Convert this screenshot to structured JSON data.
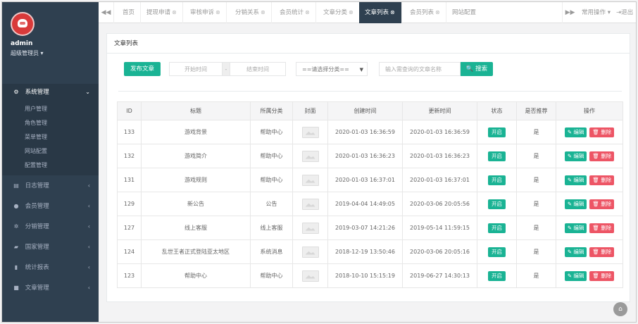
{
  "sidebar": {
    "user_name": "admin",
    "user_role": "超级管理员 ▾",
    "active_menu": {
      "icon": "gear-icon",
      "glyph": "⚙",
      "label": "系统管理",
      "chevron": "⌄"
    },
    "submenu": [
      "用户管理",
      "角色管理",
      "菜单管理",
      "网站配置",
      "配置管理"
    ],
    "menus": [
      {
        "icon": "log-icon",
        "glyph": "▤",
        "label": "日志管理",
        "chevron": "‹"
      },
      {
        "icon": "user-icon",
        "glyph": "●",
        "label": "会员管理",
        "chevron": "‹"
      },
      {
        "icon": "network-icon",
        "glyph": "✲",
        "label": "分销管理",
        "chevron": "‹"
      },
      {
        "icon": "book-icon",
        "glyph": "▰",
        "label": "国家管理",
        "chevron": "‹"
      },
      {
        "icon": "chart-icon",
        "glyph": "▮",
        "label": "统计报表",
        "chevron": "‹"
      },
      {
        "icon": "document-icon",
        "glyph": "■",
        "label": "文章管理",
        "chevron": "‹"
      }
    ]
  },
  "tabbar": {
    "back_glyph": "◀◀",
    "close_glyph": "⊗",
    "tabs": [
      {
        "label": "首页",
        "closable": false,
        "active": false
      },
      {
        "label": "提现申请",
        "closable": true,
        "active": false
      },
      {
        "label": "审核申诉",
        "closable": true,
        "active": false
      },
      {
        "label": "分销关系",
        "closable": true,
        "active": false
      },
      {
        "label": "会员统计",
        "closable": true,
        "active": false
      },
      {
        "label": "文章分类",
        "closable": true,
        "active": false
      },
      {
        "label": "文章列表",
        "closable": true,
        "active": true
      },
      {
        "label": "会员列表",
        "closable": true,
        "active": false
      },
      {
        "label": "网站配置",
        "closable": false,
        "active": false
      }
    ],
    "forward_glyph": "▶▶",
    "common_ops": "常用操作 ▾",
    "logout": "⇥退出"
  },
  "panel": {
    "title": "文章列表",
    "publish_button": "发布文章",
    "start_time_placeholder": "开始时间",
    "range_sep": "-",
    "end_time_placeholder": "结束时间",
    "category_select": "==请选择分类==",
    "select_arrow": "▼",
    "search_placeholder": "输入需查询的文章名称",
    "search_button": "🔍 搜索"
  },
  "table": {
    "headers": [
      "ID",
      "标题",
      "所属分类",
      "封面",
      "创建时间",
      "更新时间",
      "状态",
      "是否推荐",
      "操作"
    ],
    "edit_label": "✎ 编辑",
    "delete_label": "🗑 删除",
    "rows": [
      {
        "id": "133",
        "title": "游戏背景",
        "category": "帮助中心",
        "created": "2020-01-03 16:36:59",
        "updated": "2020-01-03 16:36:59",
        "status": "开启",
        "recommended": "是"
      },
      {
        "id": "132",
        "title": "游戏简介",
        "category": "帮助中心",
        "created": "2020-01-03 16:36:23",
        "updated": "2020-01-03 16:36:23",
        "status": "开启",
        "recommended": "是"
      },
      {
        "id": "131",
        "title": "游戏规则",
        "category": "帮助中心",
        "created": "2020-01-03 16:37:01",
        "updated": "2020-01-03 16:37:01",
        "status": "开启",
        "recommended": "是"
      },
      {
        "id": "129",
        "title": "新公告",
        "category": "公告",
        "created": "2019-04-04 14:49:05",
        "updated": "2020-03-06 20:05:56",
        "status": "开启",
        "recommended": "是"
      },
      {
        "id": "127",
        "title": "线上客服",
        "category": "线上客服",
        "created": "2019-03-07 14:21:26",
        "updated": "2019-05-14 11:59:15",
        "status": "开启",
        "recommended": "是"
      },
      {
        "id": "124",
        "title": "乱世王者正式登陆亚太地区",
        "category": "系统消息",
        "created": "2018-12-19 13:50:46",
        "updated": "2020-03-06 20:05:16",
        "status": "开启",
        "recommended": "是"
      },
      {
        "id": "123",
        "title": "帮助中心",
        "category": "帮助中心",
        "created": "2018-10-10 15:15:19",
        "updated": "2019-06-27 14:30:13",
        "status": "开启",
        "recommended": "是"
      }
    ]
  },
  "colors": {
    "sidebar": "#2f4050",
    "accent": "#1ab394",
    "danger": "#ed5565"
  }
}
